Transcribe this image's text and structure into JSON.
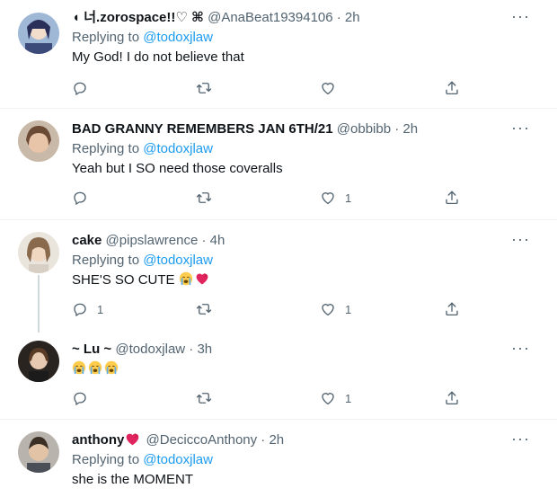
{
  "tweets": [
    {
      "name": "◖ 너.zorospace!!♡ ⌘",
      "handle": "@AnaBeat19394106 · 2h",
      "replying_prefix": "Replying to",
      "mention": "@todoxjlaw",
      "text": "My God! I do not believe that",
      "counts": {
        "reply": "",
        "retweet": "",
        "like": ""
      }
    },
    {
      "name": "BAD GRANNY REMEMBERS JAN 6TH/21",
      "handle": "@obbibb · 2h",
      "replying_prefix": "Replying to",
      "mention": "@todoxjlaw",
      "text": "Yeah but I SO need those coveralls",
      "counts": {
        "reply": "",
        "retweet": "",
        "like": "1"
      }
    },
    {
      "name": "cake",
      "handle": "@pipslawrence · 4h",
      "replying_prefix": "Replying to",
      "mention": "@todoxjlaw",
      "text": "SHE'S SO CUTE",
      "counts": {
        "reply": "1",
        "retweet": "",
        "like": "1"
      }
    },
    {
      "name": "~ Lu ~",
      "handle": "@todoxjlaw · 3h",
      "text": "",
      "counts": {
        "reply": "",
        "retweet": "",
        "like": "1"
      }
    },
    {
      "name": "anthony",
      "handle": "@DeciccoAnthony · 2h",
      "replying_prefix": "Replying to",
      "mention": "@todoxjlaw",
      "text": "she is the MOMENT"
    }
  ],
  "more_glyph": "···",
  "colors": {
    "accent": "#1d9bf0",
    "secondary_text": "#536471",
    "heart": "#e0245e"
  },
  "icons": [
    "reply-icon",
    "retweet-icon",
    "like-icon",
    "share-icon",
    "more-icon",
    "crying-emoji-icon",
    "heart-emoji-icon"
  ]
}
